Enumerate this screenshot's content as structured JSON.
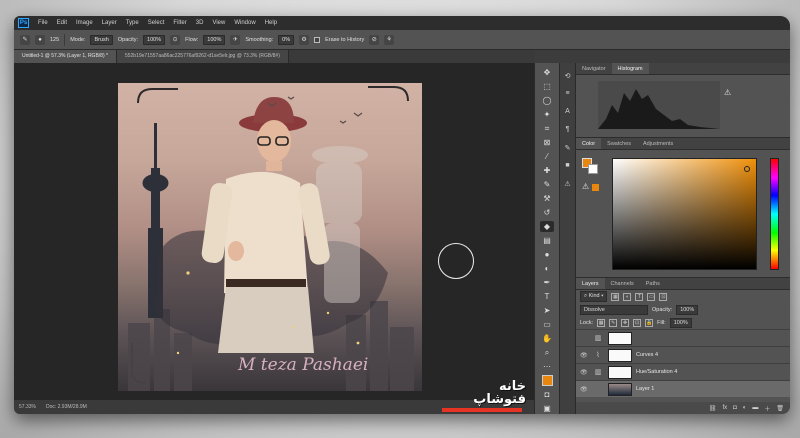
{
  "menubar": {
    "app_logo": "Ps",
    "items": [
      "File",
      "Edit",
      "Image",
      "Layer",
      "Type",
      "Select",
      "Filter",
      "3D",
      "View",
      "Window",
      "Help"
    ]
  },
  "options_bar": {
    "brush_size": "125",
    "mode_label": "Mode:",
    "mode_value": "Brush",
    "opacity_label": "Opacity:",
    "opacity_value": "100%",
    "flow_label": "Flow:",
    "flow_value": "100%",
    "smoothing_label": "Smoothing:",
    "smoothing_value": "0%",
    "erase_history_label": "Erase to History"
  },
  "tabs": [
    {
      "label": "Untitled-1 @ 57.3% (Layer 1, RGB/8) *",
      "active": true
    },
    {
      "label": "552b19e71557aa86ac225776af9262-d1se5elr.jpg @ 73.3% (RGB/8#)",
      "active": false
    }
  ],
  "canvas": {
    "signature": "M teza Pashaei"
  },
  "status_bar": {
    "zoom": "57.33%",
    "doc_info": "Doc: 2.93M/28.9M"
  },
  "panels": {
    "top_tabs": [
      {
        "label": "Navigator",
        "active": false
      },
      {
        "label": "Histogram",
        "active": true
      }
    ],
    "color_tabs": [
      {
        "label": "Color",
        "active": true
      },
      {
        "label": "Swatches",
        "active": false
      },
      {
        "label": "Adjustments",
        "active": false
      }
    ],
    "layers_tabs": [
      {
        "label": "Layers",
        "active": true
      },
      {
        "label": "Channels",
        "active": false
      },
      {
        "label": "Paths",
        "active": false
      }
    ],
    "kind_label": "Kind",
    "blend_mode": "Dissolve",
    "opacity_label": "Opacity:",
    "opacity_value": "100%",
    "lock_label": "Lock:",
    "fill_label": "Fill:",
    "fill_value": "100%",
    "layers": [
      {
        "name": "",
        "type": "adjustment"
      },
      {
        "name": "Curves 4",
        "type": "adjustment"
      },
      {
        "name": "Hue/Saturation 4",
        "type": "adjustment"
      },
      {
        "name": "Layer 1",
        "type": "pixel",
        "selected": true
      }
    ]
  },
  "watermark": {
    "text": "خانه فتوشاپ"
  },
  "colors": {
    "foreground": "#e8860d",
    "accent": "#31a8ff",
    "watermark_bar": "#e63323"
  }
}
